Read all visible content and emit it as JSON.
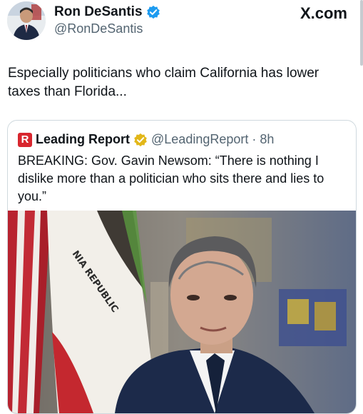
{
  "post": {
    "display_name": "Ron DeSantis",
    "handle": "@RonDeSantis",
    "site_label": "X.com",
    "text": "Especially politicians who claim California has lower taxes than Florida..."
  },
  "quote": {
    "logo_letter": "R",
    "display_name": "Leading Report",
    "handle": "@LeadingReport",
    "separator": "·",
    "time": "8h",
    "text": "BREAKING: Gov. Gavin Newsom: “There is nothing I dislike more than a politician who sits there and lies to you.”"
  },
  "image_flag_text": "NIA REPUBLIC",
  "icons": {
    "verified_post": "verified-blue-badge-icon",
    "verified_quote": "verified-gold-badge-icon"
  },
  "colors": {
    "verified_blue": "#1d9bf0",
    "verified_gold": "#e2b719",
    "brand_red": "#d8262e",
    "secondary_text": "#536471",
    "border": "#cfd9de"
  }
}
